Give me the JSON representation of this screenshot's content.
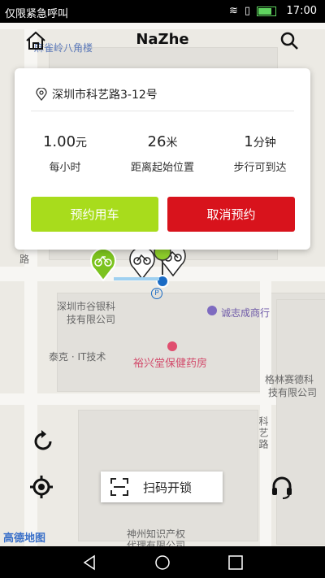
{
  "status_bar": {
    "carrier_text": "仅限紧急呼叫",
    "time": "17:00"
  },
  "app": {
    "title": "NaZhe"
  },
  "card": {
    "address": "深圳市科艺路3-12号",
    "stats": [
      {
        "value": "1.00",
        "unit": "元",
        "label": "每小时"
      },
      {
        "value": "26",
        "unit": "米",
        "label": "距离起始位置"
      },
      {
        "value": "1",
        "unit": "分钟",
        "label": "步行可到达"
      }
    ],
    "reserve_label": "预约用车",
    "cancel_label": "取消预约"
  },
  "map": {
    "labels": {
      "top_building": "麻雀岭八角楼",
      "road_small": "路",
      "company1_line1": "深圳市谷银科",
      "company1_line2": "技有限公司",
      "shop": "诚志成商行",
      "tech": "泰克 · IT技术",
      "pharmacy": "裕兴堂保健药房",
      "company2_line1": "格林赛德科",
      "company2_line2": "技有限公司",
      "road_keyi": "科艺路",
      "ip_line1": "神州知识产权",
      "ip_line2": "代理有限公司",
      "amap": "高德地图"
    }
  },
  "scan_label": "扫码开锁",
  "colors": {
    "reserve": "#a8dc1c",
    "cancel": "#d8131c",
    "marker": "#7cc31f",
    "location": "#1a6bc4"
  }
}
